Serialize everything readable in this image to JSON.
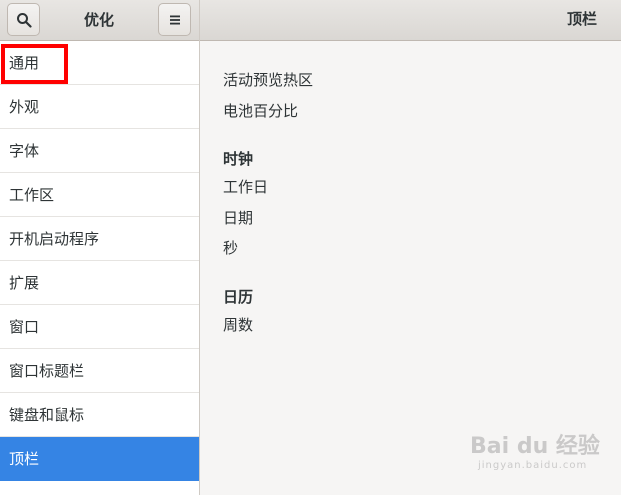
{
  "header": {
    "left_title": "优化",
    "right_title": "顶栏",
    "search_icon": "search-icon",
    "menu_icon": "hamburger-menu-icon"
  },
  "sidebar": {
    "items": [
      {
        "label": "通用"
      },
      {
        "label": "外观"
      },
      {
        "label": "字体"
      },
      {
        "label": "工作区"
      },
      {
        "label": "开机启动程序"
      },
      {
        "label": "扩展"
      },
      {
        "label": "窗口"
      },
      {
        "label": "窗口标题栏"
      },
      {
        "label": "键盘和鼠标"
      },
      {
        "label": "顶栏"
      }
    ],
    "selected_color": "#3584e4"
  },
  "main": {
    "options_top": [
      "活动预览热区",
      "电池百分比"
    ],
    "clock": {
      "heading": "时钟",
      "options": [
        "工作日",
        "日期",
        "秒"
      ]
    },
    "calendar": {
      "heading": "日历",
      "options": [
        "周数"
      ]
    }
  },
  "watermark": {
    "text": "Bai du 经验",
    "sub": "jingyan.baidu.com"
  }
}
